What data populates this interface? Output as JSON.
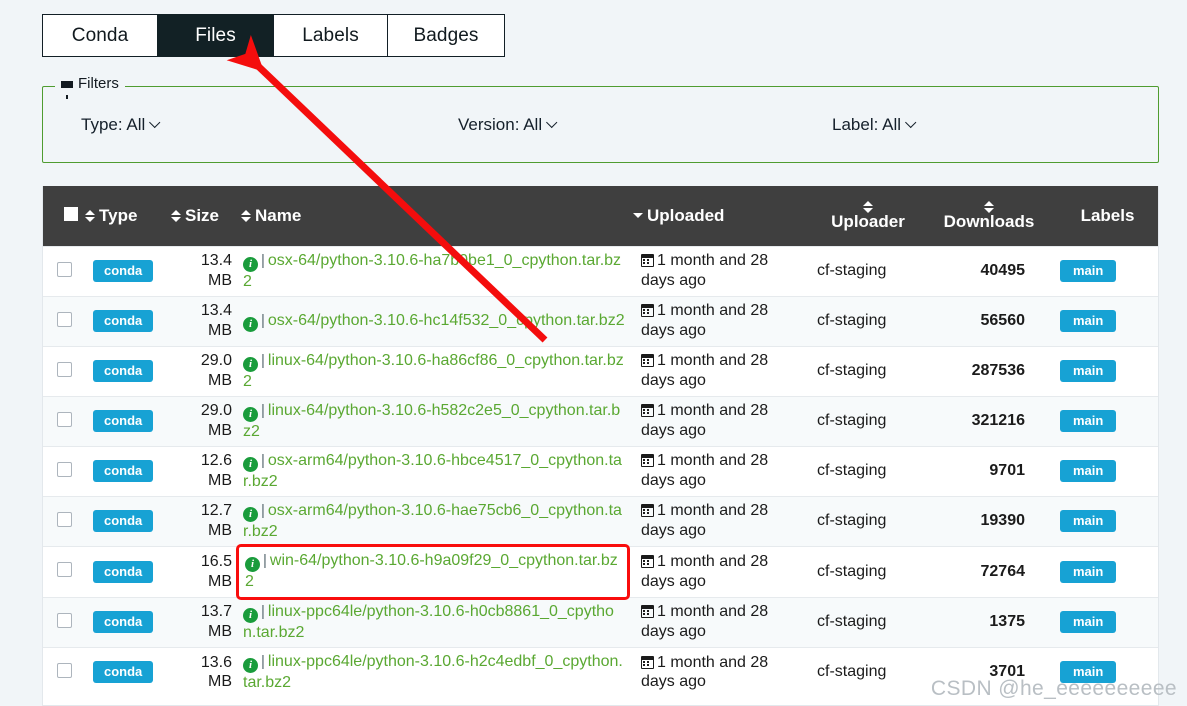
{
  "tabs": [
    {
      "label": "Conda",
      "active": false
    },
    {
      "label": "Files",
      "active": true
    },
    {
      "label": "Labels",
      "active": false
    },
    {
      "label": "Badges",
      "active": false
    }
  ],
  "filters": {
    "legend": "Filters",
    "type": {
      "label": "Type: All"
    },
    "version": {
      "label": "Version: All"
    },
    "label": {
      "label": "Label: All"
    }
  },
  "table": {
    "headers": {
      "type": "Type",
      "size": "Size",
      "name": "Name",
      "uploaded": "Uploaded",
      "uploader": "Uploader",
      "downloads": "Downloads",
      "labels": "Labels"
    },
    "sort": {
      "column": "Uploaded",
      "direction": "desc"
    },
    "rows": [
      {
        "type": "conda",
        "size": "13.4 MB",
        "name": "osx-64/python-3.10.6-ha7b0be1_0_cpython.tar.bz2",
        "uploaded": "1 month and 28 days ago",
        "uploader": "cf-staging",
        "downloads": "40495",
        "label": "main",
        "highlighted": false
      },
      {
        "type": "conda",
        "size": "13.4 MB",
        "name": "osx-64/python-3.10.6-hc14f532_0_cpython.tar.bz2",
        "uploaded": "1 month and 28 days ago",
        "uploader": "cf-staging",
        "downloads": "56560",
        "label": "main",
        "highlighted": false
      },
      {
        "type": "conda",
        "size": "29.0 MB",
        "name": "linux-64/python-3.10.6-ha86cf86_0_cpython.tar.bz2",
        "uploaded": "1 month and 28 days ago",
        "uploader": "cf-staging",
        "downloads": "287536",
        "label": "main",
        "highlighted": false
      },
      {
        "type": "conda",
        "size": "29.0 MB",
        "name": "linux-64/python-3.10.6-h582c2e5_0_cpython.tar.bz2",
        "uploaded": "1 month and 28 days ago",
        "uploader": "cf-staging",
        "downloads": "321216",
        "label": "main",
        "highlighted": false
      },
      {
        "type": "conda",
        "size": "12.6 MB",
        "name": "osx-arm64/python-3.10.6-hbce4517_0_cpython.tar.bz2",
        "uploaded": "1 month and 28 days ago",
        "uploader": "cf-staging",
        "downloads": "9701",
        "label": "main",
        "highlighted": false
      },
      {
        "type": "conda",
        "size": "12.7 MB",
        "name": "osx-arm64/python-3.10.6-hae75cb6_0_cpython.tar.bz2",
        "uploaded": "1 month and 28 days ago",
        "uploader": "cf-staging",
        "downloads": "19390",
        "label": "main",
        "highlighted": false
      },
      {
        "type": "conda",
        "size": "16.5 MB",
        "name": "win-64/python-3.10.6-h9a09f29_0_cpython.tar.bz2",
        "uploaded": "1 month and 28 days ago",
        "uploader": "cf-staging",
        "downloads": "72764",
        "label": "main",
        "highlighted": true
      },
      {
        "type": "conda",
        "size": "13.7 MB",
        "name": "linux-ppc64le/python-3.10.6-h0cb8861_0_cpython.tar.bz2",
        "uploaded": "1 month and 28 days ago",
        "uploader": "cf-staging",
        "downloads": "1375",
        "label": "main",
        "highlighted": false
      },
      {
        "type": "conda",
        "size": "13.6 MB",
        "name": "linux-ppc64le/python-3.10.6-h2c4edbf_0_cpython.tar.bz2",
        "uploaded": "1 month and 28 days ago",
        "uploader": "cf-staging",
        "downloads": "3701",
        "label": "main",
        "highlighted": false
      }
    ]
  },
  "annotation": {
    "arrow_color": "#f40d0d",
    "highlight_color": "#f90d0d"
  },
  "watermark": {
    "text": "CSDN @he_eeeeeeeeee"
  },
  "colors": {
    "accent_badge": "#17a2d4",
    "filter_border": "#4f9c30",
    "tab_active_bg": "#122125",
    "header_bg": "#3f3f3f",
    "link_green": "#5aa832",
    "page_bg": "#f1f5f8"
  }
}
